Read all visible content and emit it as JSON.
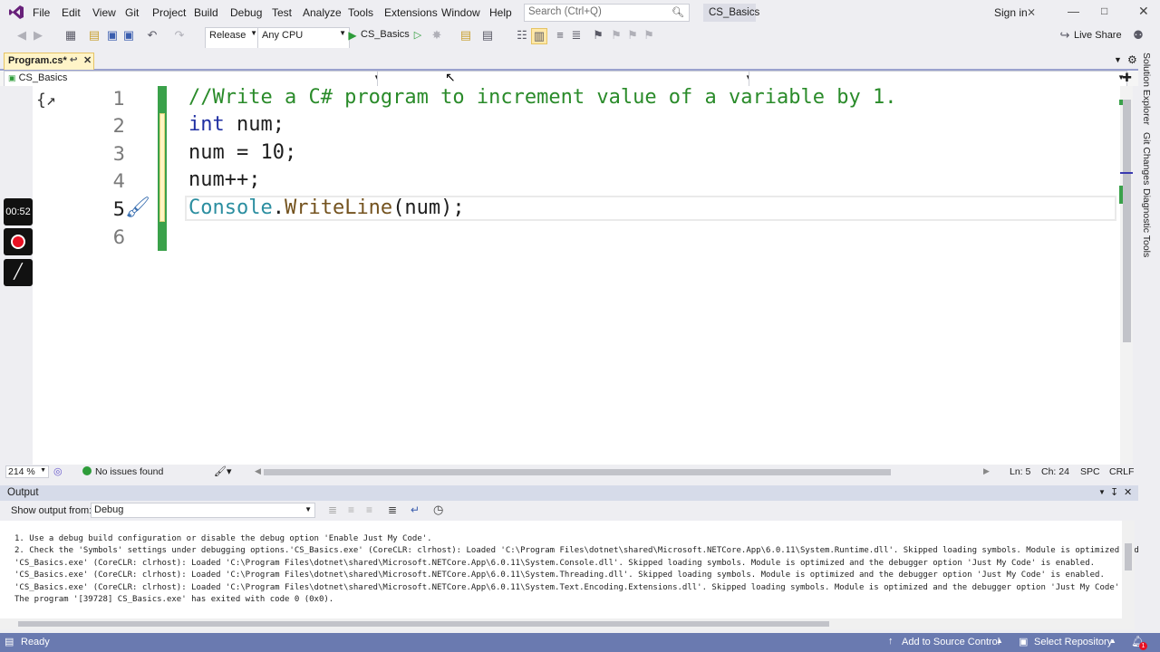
{
  "menu": {
    "items": [
      "File",
      "Edit",
      "View",
      "Git",
      "Project",
      "Build",
      "Debug",
      "Test",
      "Analyze",
      "Tools",
      "Extensions",
      "Window",
      "Help"
    ],
    "search_placeholder": "Search (Ctrl+Q)",
    "solution_name": "CS_Basics",
    "sign_in": "Sign in"
  },
  "toolbar": {
    "configuration": "Release",
    "platform": "Any CPU",
    "start_target": "CS_Basics",
    "live_share": "Live Share"
  },
  "tabs": [
    {
      "label": "Program.cs*"
    }
  ],
  "navbar": {
    "project": "CS_Basics",
    "type": "",
    "member": ""
  },
  "editor": {
    "lines": [
      {
        "n": "1"
      },
      {
        "n": "2"
      },
      {
        "n": "3"
      },
      {
        "n": "4"
      },
      {
        "n": "5"
      },
      {
        "n": "6"
      }
    ],
    "code": {
      "l1": "//Write a C# program to increment value of a variable by 1.",
      "l2_kw": "int",
      "l2_rest": " num;",
      "l3": "num = 10;",
      "l4": "num++;",
      "l5_type": "Console",
      "l5_dot": ".",
      "l5_meth": "WriteLine",
      "l5_rest": "(num);"
    },
    "timer": "00:52",
    "zoom": "214 %",
    "issues": "No issues found",
    "line_pos": "Ln: 5",
    "col_pos": "Ch: 24",
    "indent": "SPC",
    "line_ending": "CRLF"
  },
  "side_panels": [
    "Solution Explorer",
    "Git Changes",
    "Diagnostic Tools"
  ],
  "output": {
    "title": "Output",
    "show_from_label": "Show output from:",
    "source": "Debug",
    "lines": [
      "1. Use a debug build configuration or disable the debug option 'Enable Just My Code'.",
      "2. Check the 'Symbols' settings under debugging options.'CS_Basics.exe' (CoreCLR: clrhost): Loaded 'C:\\Program Files\\dotnet\\shared\\Microsoft.NETCore.App\\6.0.11\\System.Runtime.dll'. Skipped loading symbols. Module is optimized and",
      "'CS_Basics.exe' (CoreCLR: clrhost): Loaded 'C:\\Program Files\\dotnet\\shared\\Microsoft.NETCore.App\\6.0.11\\System.Console.dll'. Skipped loading symbols. Module is optimized and the debugger option 'Just My Code' is enabled.",
      "'CS_Basics.exe' (CoreCLR: clrhost): Loaded 'C:\\Program Files\\dotnet\\shared\\Microsoft.NETCore.App\\6.0.11\\System.Threading.dll'. Skipped loading symbols. Module is optimized and the debugger option 'Just My Code' is enabled.",
      "'CS_Basics.exe' (CoreCLR: clrhost): Loaded 'C:\\Program Files\\dotnet\\shared\\Microsoft.NETCore.App\\6.0.11\\System.Text.Encoding.Extensions.dll'. Skipped loading symbols. Module is optimized and the debugger option 'Just My Code' is",
      "The program '[39728] CS_Basics.exe' has exited with code 0 (0x0)."
    ]
  },
  "statusbar": {
    "ready": "Ready",
    "add_source": "Add to Source Control",
    "select_repo": "Select Repository",
    "notifications": "1"
  },
  "colors": {
    "accent": "#68217a",
    "status_bar": "#6a7ab0",
    "comment": "#2a8b2a",
    "keyword": "#1f2fa2",
    "type": "#2b8ea0",
    "method": "#74531f"
  }
}
